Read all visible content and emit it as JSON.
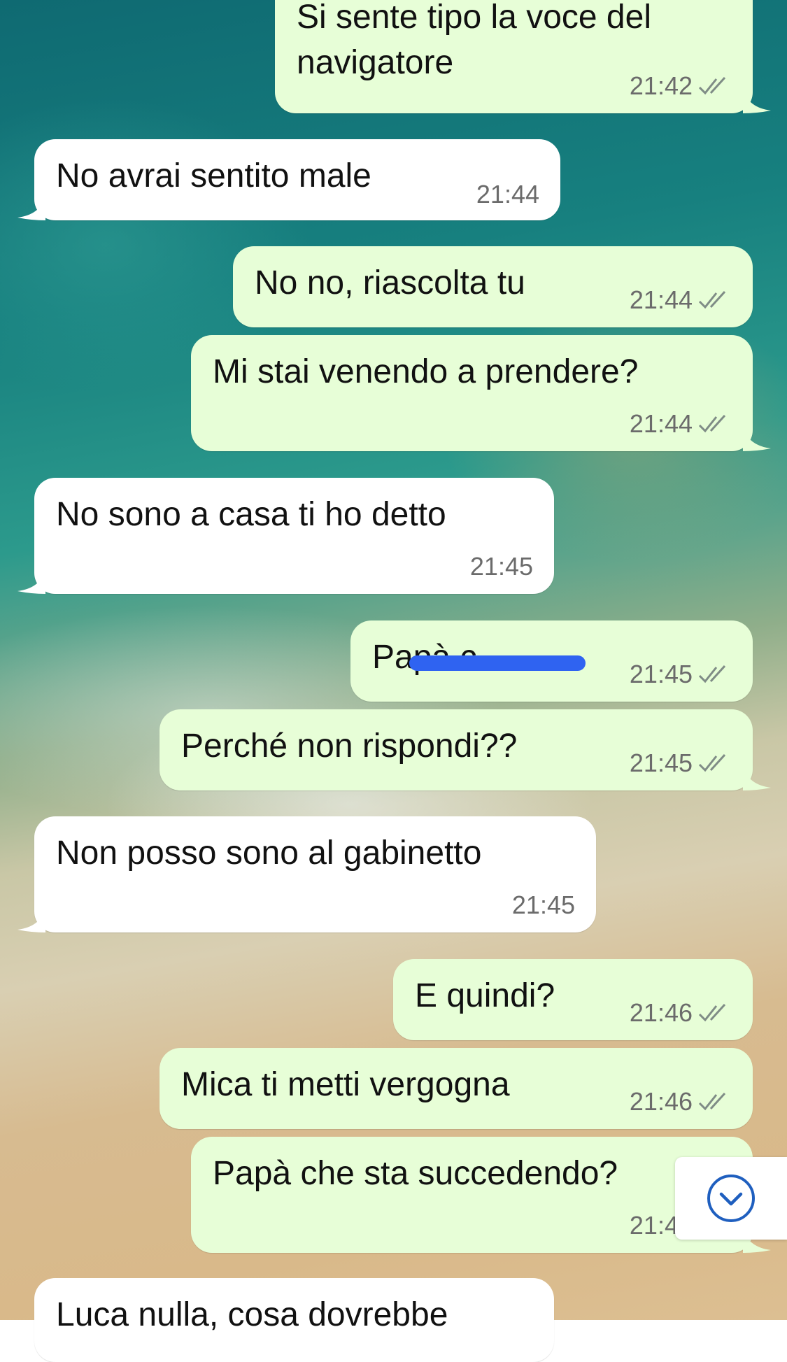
{
  "messages": [
    {
      "dir": "out",
      "lines": [
        "Si sente tipo la voce del",
        "navigatore"
      ],
      "time": "21:42",
      "read": true
    },
    {
      "dir": "in",
      "lines": [
        "No avrai sentito male"
      ],
      "time": "21:44"
    },
    {
      "dir": "out",
      "lines": [
        "No no, riascolta tu"
      ],
      "time": "21:44",
      "read": true
    },
    {
      "dir": "out",
      "lines": [
        "Mi stai venendo a prendere?"
      ],
      "time": "21:44",
      "read": true
    },
    {
      "dir": "in",
      "lines": [
        "No sono a casa ti ho detto"
      ],
      "time": "21:45"
    },
    {
      "dir": "out",
      "lines": [
        "Papà c"
      ],
      "time": "21:45",
      "read": true,
      "redacted": true
    },
    {
      "dir": "out",
      "lines": [
        "Perché non rispondi??"
      ],
      "time": "21:45",
      "read": true
    },
    {
      "dir": "in",
      "lines": [
        "Non posso sono al gabinetto"
      ],
      "time": "21:45"
    },
    {
      "dir": "out",
      "lines": [
        "E quindi?"
      ],
      "time": "21:46",
      "read": true
    },
    {
      "dir": "out",
      "lines": [
        "Mica ti metti vergogna"
      ],
      "time": "21:46",
      "read": true
    },
    {
      "dir": "out",
      "lines": [
        "Papà che sta succedendo?"
      ],
      "time": "21:46",
      "read": true
    },
    {
      "dir": "in",
      "lines": [
        "Luca nulla, cosa dovrebbe"
      ],
      "time": ""
    }
  ],
  "icons": {
    "read_receipt": "double-check-icon",
    "scroll_down": "chevron-down-circle-icon"
  },
  "colors": {
    "outgoing_bubble": "#e7fed7",
    "incoming_bubble": "#ffffff",
    "accent": "#1f5fbf",
    "redaction": "#2f63f1"
  }
}
